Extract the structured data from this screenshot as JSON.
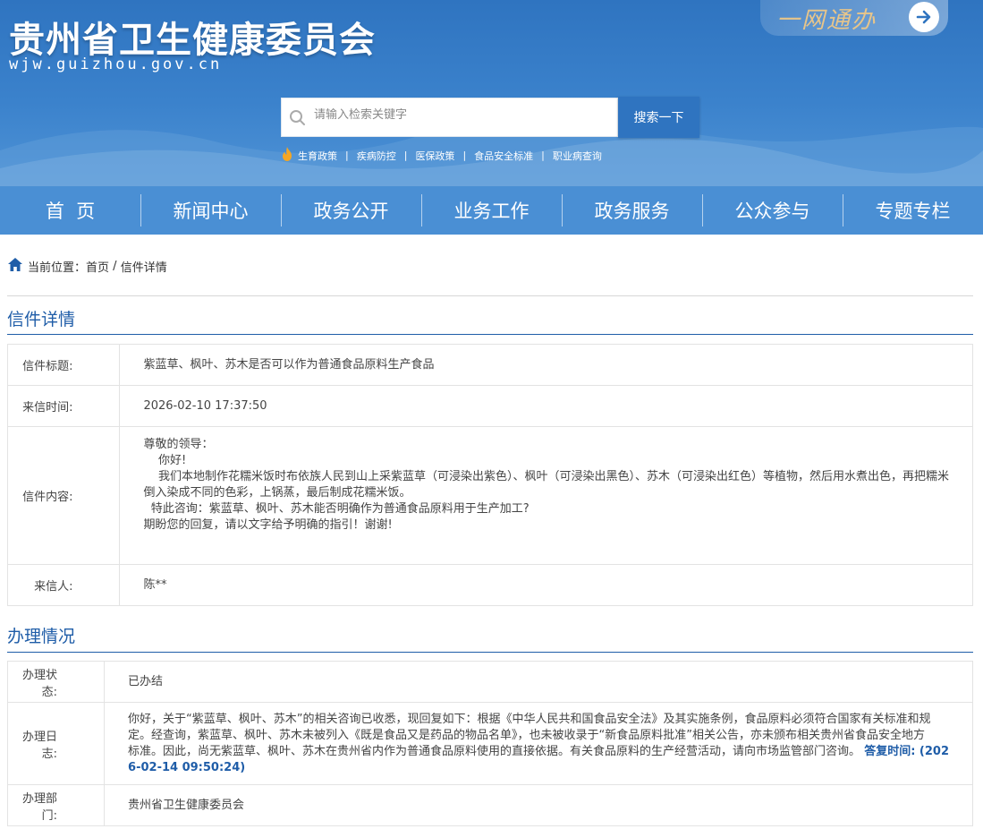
{
  "header": {
    "site_title": "贵州省卫生健康委员会",
    "site_domain": "wjw.guizhou.gov.cn",
    "ywtb_label": "一网通办",
    "colors": {
      "header_blue": "#2f74c0",
      "nav_blue": "#4a8fd4",
      "accent_gold": "#e7c58a"
    }
  },
  "search": {
    "placeholder": "请输入检索关键字",
    "button_label": "搜索一下"
  },
  "hotwords": [
    "生育政策",
    "疾病防控",
    "医保政策",
    "食品安全标准",
    "职业病查询"
  ],
  "nav": [
    "首  页",
    "新闻中心",
    "政务公开",
    "业务工作",
    "政务服务",
    "公众参与",
    "专题专栏"
  ],
  "breadcrumb": {
    "prefix": "当前位置：",
    "home": "首页",
    "separator": " / ",
    "current": "信件详情"
  },
  "letter": {
    "section_title": "信件详情",
    "title_label": "信件标题:",
    "title_value": "紫蓝草、枫叶、苏木是否可以作为普通食品原料生产食品",
    "time_label": "来信时间:",
    "time_value": "2026-02-10 17:37:50",
    "content_label": "信件内容:",
    "content_lines": [
      "尊敬的领导：",
      "    你好!",
      "    我们本地制作花糯米饭时布依族人民到山上采紫蓝草（可浸染出紫色）、枫叶（可浸染出黑色）、苏木（可浸染出红色）等植物，然后用水煮出色，再把糯米",
      "倒入染成不同的色彩，上锅蒸，最后制成花糯米饭。",
      "  特此咨询：紫蓝草、枫叶、苏木能否明确作为普通食品原料用于生产加工?",
      "期盼您的回复，请以文字给予明确的指引！谢谢!"
    ],
    "sender_label": "来信人:",
    "sender_value": "陈**"
  },
  "handling": {
    "section_title": "办理情况",
    "status_label": "办理状态:",
    "status_value": "已办结",
    "log_label": "办理日志:",
    "log_lines": [
      "你好，关于“紫蓝草、枫叶、苏木”的相关咨询已收悉，现回复如下：根据《中华人民共和国食品安全法》及其实施条例，食品原料必须符合国家有关标准和规",
      "定。经查询，紫蓝草、枫叶、苏木未被列入《既是食品又是药品的物品名单》，也未被收录于“新食品原料批准”相关公告，亦未颁布相关贵州省食品安全地方",
      "标准。因此，尚无紫蓝草、枫叶、苏木在贵州省内作为普通食品原料使用的直接依据。有关食品原料的生产经营活动，请向市场监管部门咨询。"
    ],
    "reply_time_1": "答复时间: (202",
    "reply_time_2": "6-02-14 09:50:24)",
    "dept_label": "办理部门:",
    "dept_value": "贵州省卫生健康委员会"
  }
}
